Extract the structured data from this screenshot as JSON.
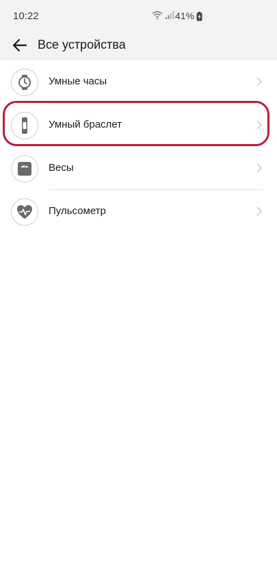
{
  "status_bar": {
    "time": "10:22",
    "battery": "41%"
  },
  "header": {
    "title": "Все устройства"
  },
  "devices": [
    {
      "label": "Умные часы",
      "icon": "watch-icon"
    },
    {
      "label": "Умный браслет",
      "icon": "band-icon"
    },
    {
      "label": "Весы",
      "icon": "scale-icon"
    },
    {
      "label": "Пульсометр",
      "icon": "heart-rate-icon"
    }
  ],
  "colors": {
    "highlight": "#b81e3d",
    "header_bg": "#f3f3f3"
  }
}
